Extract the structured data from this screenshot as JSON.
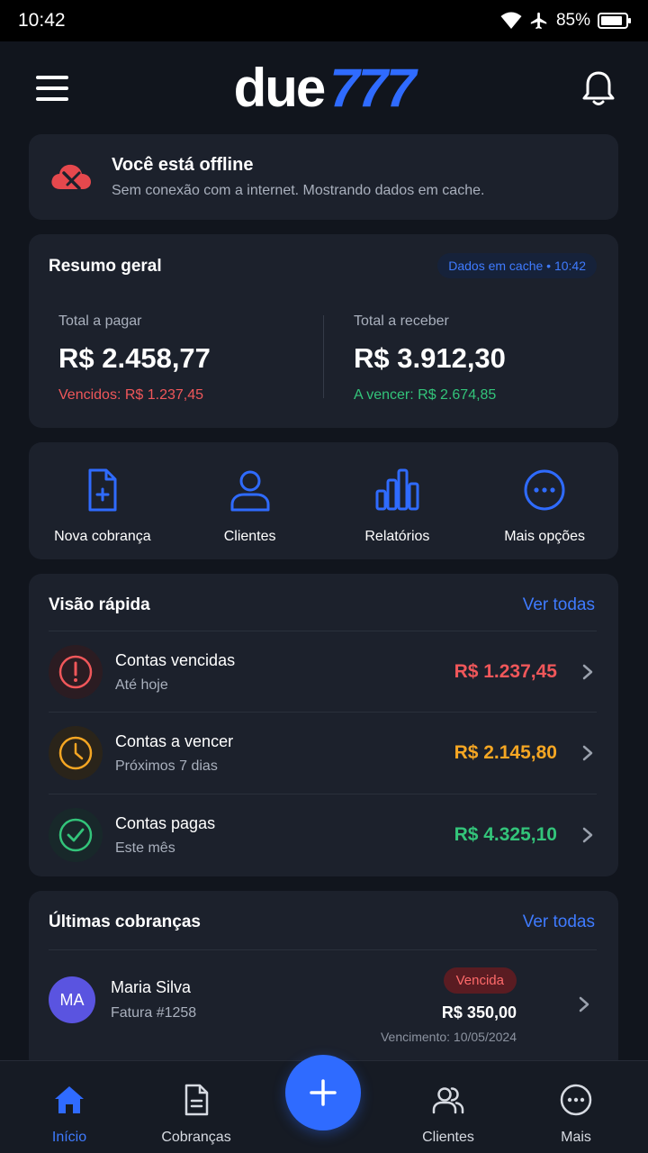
{
  "status_bar": {
    "time": "10:42",
    "battery": "85%"
  },
  "header": {
    "logo_main": "due",
    "logo_accent": "777"
  },
  "offline_banner": {
    "title": "Você está offline",
    "subtitle": "Sem conexão com a internet. Mostrando dados em cache."
  },
  "summary": {
    "title": "Resumo geral",
    "cache_badge": "Dados em cache • 10:42",
    "pay_label": "Total a pagar",
    "pay_value": "R$ 2.458,77",
    "pay_note": "Vencidos: R$ 1.237,45",
    "receive_label": "Total a receber",
    "receive_value": "R$ 3.912,30",
    "receive_note": "A vencer: R$ 2.674,85"
  },
  "actions": [
    {
      "label": "Nova cobrança",
      "icon": "new-invoice-icon"
    },
    {
      "label": "Clientes",
      "icon": "user-icon"
    },
    {
      "label": "Relatórios",
      "icon": "bar-chart-icon"
    },
    {
      "label": "Mais opções",
      "icon": "more-icon"
    }
  ],
  "quick_view": {
    "title": "Visão rápida",
    "link": "Ver todas",
    "items": [
      {
        "title": "Contas vencidas",
        "subtitle": "Até hoje",
        "amount": "R$ 1.237,45",
        "color": "#f0575a",
        "icon": "alert-icon"
      },
      {
        "title": "Contas a vencer",
        "subtitle": "Próximos 7 dias",
        "amount": "R$ 2.145,80",
        "color": "#f5a623",
        "icon": "clock-icon"
      },
      {
        "title": "Contas pagas",
        "subtitle": "Este mês",
        "amount": "R$ 4.325,10",
        "color": "#33c47a",
        "icon": "check-icon"
      }
    ]
  },
  "recent": {
    "title": "Últimas cobranças",
    "link": "Ver todas",
    "items": [
      {
        "initials": "MA",
        "name": "Maria Silva",
        "invoice": "Fatura #1258",
        "status": "Vencida",
        "amount": "R$ 350,00",
        "due": "Vencimento: 10/05/2024"
      }
    ]
  },
  "bottom_nav": {
    "items": [
      {
        "label": "Início",
        "icon": "home-icon",
        "active": true
      },
      {
        "label": "Cobranças",
        "icon": "document-icon"
      },
      {
        "label": "Clientes",
        "icon": "users-icon"
      },
      {
        "label": "Mais",
        "icon": "more-icon"
      }
    ],
    "fab_icon": "plus-icon"
  },
  "colors": {
    "accent": "#2f6bff",
    "danger": "#f0575a",
    "warning": "#f5a623",
    "success": "#33c47a"
  }
}
